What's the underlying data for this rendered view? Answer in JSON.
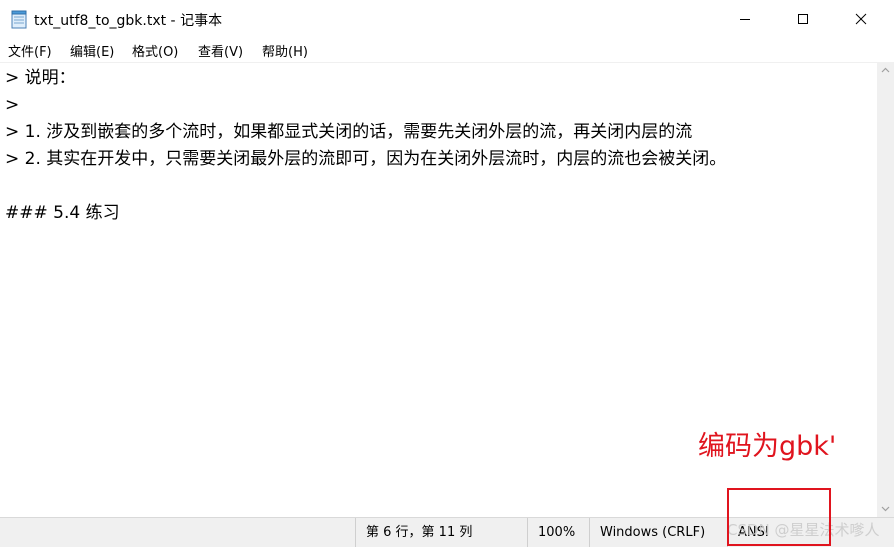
{
  "window": {
    "title": "txt_utf8_to_gbk.txt - 记事本",
    "icon": "notepad-icon",
    "buttons": {
      "minimize": "minimize-icon",
      "maximize": "maximize-icon",
      "close": "close-icon"
    }
  },
  "menu": {
    "items": [
      {
        "label": "文件(F)"
      },
      {
        "label": "编辑(E)"
      },
      {
        "label": "格式(O)"
      },
      {
        "label": "查看(V)"
      },
      {
        "label": "帮助(H)"
      }
    ]
  },
  "editor": {
    "lines": [
      "> 说明：",
      ">",
      "> 1. 涉及到嵌套的多个流时，如果都显式关闭的话，需要先关闭外层的流，再关闭内层的流",
      "> 2. 其实在开发中，只需要关闭最外层的流即可，因为在关闭外层流时，内层的流也会被关闭。",
      "",
      "### 5.4 练习"
    ]
  },
  "status": {
    "position": "第 6 行，第 11 列",
    "zoom": "100%",
    "line_ending": "Windows (CRLF)",
    "encoding": "ANSI"
  },
  "annotation": {
    "text": "编码为gbk'",
    "color": "#e0141e"
  },
  "watermark": "CSDN @星星法术嗲人"
}
